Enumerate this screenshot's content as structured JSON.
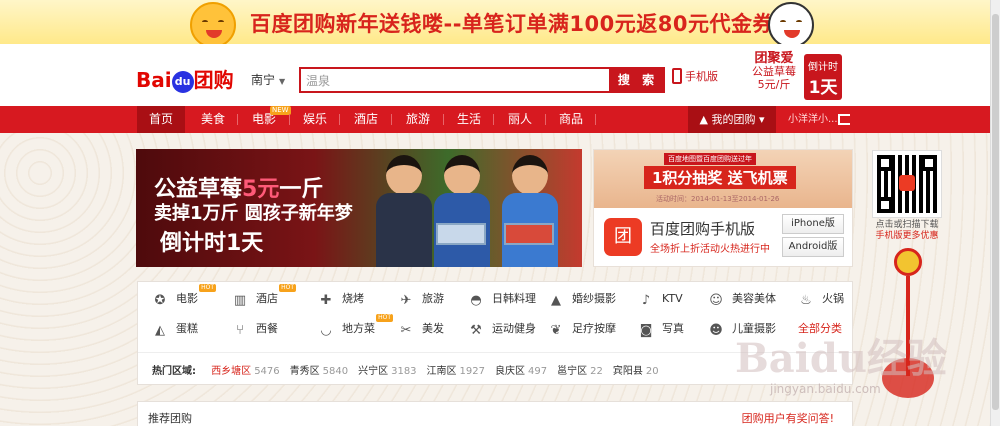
{
  "top_banner": {
    "text": "百度团购新年送钱喽--单笔订单满100元返80元代金券"
  },
  "header": {
    "logo": {
      "text1": "Bai",
      "paw": "du",
      "text2": "团购"
    },
    "city": "南宁",
    "search": {
      "value": "温泉",
      "button": "搜 索"
    },
    "mobile_link": "手机版",
    "promo": {
      "line1": "团聚爱",
      "line2": "公益草莓",
      "line3": "5元/斤"
    },
    "countdown": {
      "line1": "倒计时",
      "line2": "1天"
    }
  },
  "nav": {
    "items": [
      {
        "label": "首页",
        "active": true
      },
      {
        "label": "美食"
      },
      {
        "label": "电影",
        "badge": "NEW"
      },
      {
        "label": "娱乐"
      },
      {
        "label": "酒店"
      },
      {
        "label": "旅游"
      },
      {
        "label": "生活"
      },
      {
        "label": "丽人"
      },
      {
        "label": "商品"
      }
    ],
    "my_tuan": "我的团购",
    "user": "小洋洋小..."
  },
  "banner_left": {
    "line1a": "公益草莓",
    "line1b": "5元",
    "line1c": "一斤",
    "line2": "卖掉1万斤 圆孩子新年梦",
    "line3": "倒计时1天"
  },
  "banner_right": {
    "top_head": "百度地图暨百度团购送过年",
    "top_main": "1积分抽奖 送飞机票",
    "top_date": "活动时间：2014-01-13至2014-01-26",
    "app_icon": "团",
    "app_title": "百度团购手机版",
    "app_sub": "全场折上折活动火热进行中",
    "btn_iphone": "iPhone版",
    "btn_android": "Android版"
  },
  "qr": {
    "line1": "点击或扫描下载",
    "line2": "手机版更多优惠"
  },
  "categories": {
    "row1": [
      {
        "label": "电影",
        "icon": "film-icon",
        "glyph": "✪",
        "hot": "HOT"
      },
      {
        "label": "酒店",
        "icon": "building-icon",
        "glyph": "▥",
        "hot": "HOT"
      },
      {
        "label": "烧烤",
        "icon": "skewer-icon",
        "glyph": "✚"
      },
      {
        "label": "旅游",
        "icon": "plane-icon",
        "glyph": "✈"
      },
      {
        "label": "日韩料理",
        "icon": "bowl-icon",
        "glyph": "◓"
      },
      {
        "label": "婚纱摄影",
        "icon": "dress-icon",
        "glyph": "▲"
      },
      {
        "label": "KTV",
        "icon": "mic-icon",
        "glyph": "♪"
      },
      {
        "label": "美容美体",
        "icon": "face-icon",
        "glyph": "☺"
      },
      {
        "label": "火锅",
        "icon": "pot-icon",
        "glyph": "♨"
      }
    ],
    "row2": [
      {
        "label": "蛋糕",
        "icon": "cake-icon",
        "glyph": "◭"
      },
      {
        "label": "西餐",
        "icon": "fork-knife-icon",
        "glyph": "⑂"
      },
      {
        "label": "地方菜",
        "icon": "dish-icon",
        "glyph": "◡",
        "hot": "HOT"
      },
      {
        "label": "美发",
        "icon": "scissors-comb-icon",
        "glyph": "✂"
      },
      {
        "label": "运动健身",
        "icon": "dumbbell-icon",
        "glyph": "⚒"
      },
      {
        "label": "足疗按摩",
        "icon": "feet-icon",
        "glyph": "❦"
      },
      {
        "label": "写真",
        "icon": "camera-icon",
        "glyph": "◙"
      },
      {
        "label": "儿童摄影",
        "icon": "child-icon",
        "glyph": "☻"
      },
      {
        "label": "全部分类",
        "all": true
      }
    ]
  },
  "hot_areas": {
    "title": "热门区域:",
    "items": [
      {
        "name": "西乡塘区",
        "count": "5476",
        "active": true
      },
      {
        "name": "青秀区",
        "count": "5840"
      },
      {
        "name": "兴宁区",
        "count": "3183"
      },
      {
        "name": "江南区",
        "count": "1927"
      },
      {
        "name": "良庆区",
        "count": "497"
      },
      {
        "name": "邕宁区",
        "count": "22"
      },
      {
        "name": "宾阳县",
        "count": "20"
      }
    ]
  },
  "recommend": {
    "title": "推荐团购",
    "right": "团购用户有奖问答!"
  },
  "watermark": {
    "text": "Baidu经验",
    "url": "jingyan.baidu.com"
  },
  "colors": {
    "brand_red": "#d71920",
    "accent_red": "#c8161d",
    "hot_orange": "#f7a21b"
  }
}
